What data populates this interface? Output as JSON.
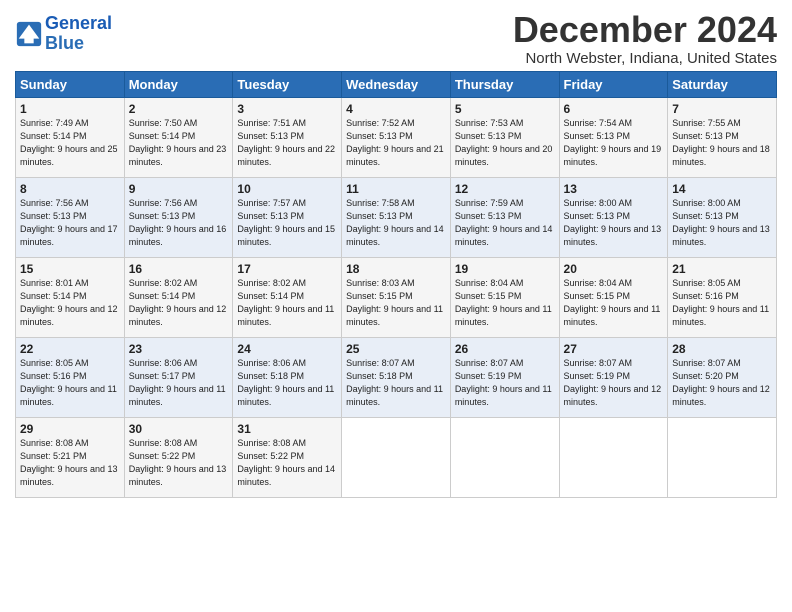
{
  "logo": {
    "text_general": "General",
    "text_blue": "Blue"
  },
  "header": {
    "month_year": "December 2024",
    "location": "North Webster, Indiana, United States"
  },
  "days_of_week": [
    "Sunday",
    "Monday",
    "Tuesday",
    "Wednesday",
    "Thursday",
    "Friday",
    "Saturday"
  ],
  "weeks": [
    [
      {
        "day": "1",
        "sunrise": "7:49 AM",
        "sunset": "5:14 PM",
        "daylight": "9 hours and 25 minutes."
      },
      {
        "day": "2",
        "sunrise": "7:50 AM",
        "sunset": "5:14 PM",
        "daylight": "9 hours and 23 minutes."
      },
      {
        "day": "3",
        "sunrise": "7:51 AM",
        "sunset": "5:13 PM",
        "daylight": "9 hours and 22 minutes."
      },
      {
        "day": "4",
        "sunrise": "7:52 AM",
        "sunset": "5:13 PM",
        "daylight": "9 hours and 21 minutes."
      },
      {
        "day": "5",
        "sunrise": "7:53 AM",
        "sunset": "5:13 PM",
        "daylight": "9 hours and 20 minutes."
      },
      {
        "day": "6",
        "sunrise": "7:54 AM",
        "sunset": "5:13 PM",
        "daylight": "9 hours and 19 minutes."
      },
      {
        "day": "7",
        "sunrise": "7:55 AM",
        "sunset": "5:13 PM",
        "daylight": "9 hours and 18 minutes."
      }
    ],
    [
      {
        "day": "8",
        "sunrise": "7:56 AM",
        "sunset": "5:13 PM",
        "daylight": "9 hours and 17 minutes."
      },
      {
        "day": "9",
        "sunrise": "7:56 AM",
        "sunset": "5:13 PM",
        "daylight": "9 hours and 16 minutes."
      },
      {
        "day": "10",
        "sunrise": "7:57 AM",
        "sunset": "5:13 PM",
        "daylight": "9 hours and 15 minutes."
      },
      {
        "day": "11",
        "sunrise": "7:58 AM",
        "sunset": "5:13 PM",
        "daylight": "9 hours and 14 minutes."
      },
      {
        "day": "12",
        "sunrise": "7:59 AM",
        "sunset": "5:13 PM",
        "daylight": "9 hours and 14 minutes."
      },
      {
        "day": "13",
        "sunrise": "8:00 AM",
        "sunset": "5:13 PM",
        "daylight": "9 hours and 13 minutes."
      },
      {
        "day": "14",
        "sunrise": "8:00 AM",
        "sunset": "5:13 PM",
        "daylight": "9 hours and 13 minutes."
      }
    ],
    [
      {
        "day": "15",
        "sunrise": "8:01 AM",
        "sunset": "5:14 PM",
        "daylight": "9 hours and 12 minutes."
      },
      {
        "day": "16",
        "sunrise": "8:02 AM",
        "sunset": "5:14 PM",
        "daylight": "9 hours and 12 minutes."
      },
      {
        "day": "17",
        "sunrise": "8:02 AM",
        "sunset": "5:14 PM",
        "daylight": "9 hours and 11 minutes."
      },
      {
        "day": "18",
        "sunrise": "8:03 AM",
        "sunset": "5:15 PM",
        "daylight": "9 hours and 11 minutes."
      },
      {
        "day": "19",
        "sunrise": "8:04 AM",
        "sunset": "5:15 PM",
        "daylight": "9 hours and 11 minutes."
      },
      {
        "day": "20",
        "sunrise": "8:04 AM",
        "sunset": "5:15 PM",
        "daylight": "9 hours and 11 minutes."
      },
      {
        "day": "21",
        "sunrise": "8:05 AM",
        "sunset": "5:16 PM",
        "daylight": "9 hours and 11 minutes."
      }
    ],
    [
      {
        "day": "22",
        "sunrise": "8:05 AM",
        "sunset": "5:16 PM",
        "daylight": "9 hours and 11 minutes."
      },
      {
        "day": "23",
        "sunrise": "8:06 AM",
        "sunset": "5:17 PM",
        "daylight": "9 hours and 11 minutes."
      },
      {
        "day": "24",
        "sunrise": "8:06 AM",
        "sunset": "5:18 PM",
        "daylight": "9 hours and 11 minutes."
      },
      {
        "day": "25",
        "sunrise": "8:07 AM",
        "sunset": "5:18 PM",
        "daylight": "9 hours and 11 minutes."
      },
      {
        "day": "26",
        "sunrise": "8:07 AM",
        "sunset": "5:19 PM",
        "daylight": "9 hours and 11 minutes."
      },
      {
        "day": "27",
        "sunrise": "8:07 AM",
        "sunset": "5:19 PM",
        "daylight": "9 hours and 12 minutes."
      },
      {
        "day": "28",
        "sunrise": "8:07 AM",
        "sunset": "5:20 PM",
        "daylight": "9 hours and 12 minutes."
      }
    ],
    [
      {
        "day": "29",
        "sunrise": "8:08 AM",
        "sunset": "5:21 PM",
        "daylight": "9 hours and 13 minutes."
      },
      {
        "day": "30",
        "sunrise": "8:08 AM",
        "sunset": "5:22 PM",
        "daylight": "9 hours and 13 minutes."
      },
      {
        "day": "31",
        "sunrise": "8:08 AM",
        "sunset": "5:22 PM",
        "daylight": "9 hours and 14 minutes."
      },
      null,
      null,
      null,
      null
    ]
  ],
  "labels": {
    "sunrise": "Sunrise:",
    "sunset": "Sunset:",
    "daylight": "Daylight:"
  }
}
